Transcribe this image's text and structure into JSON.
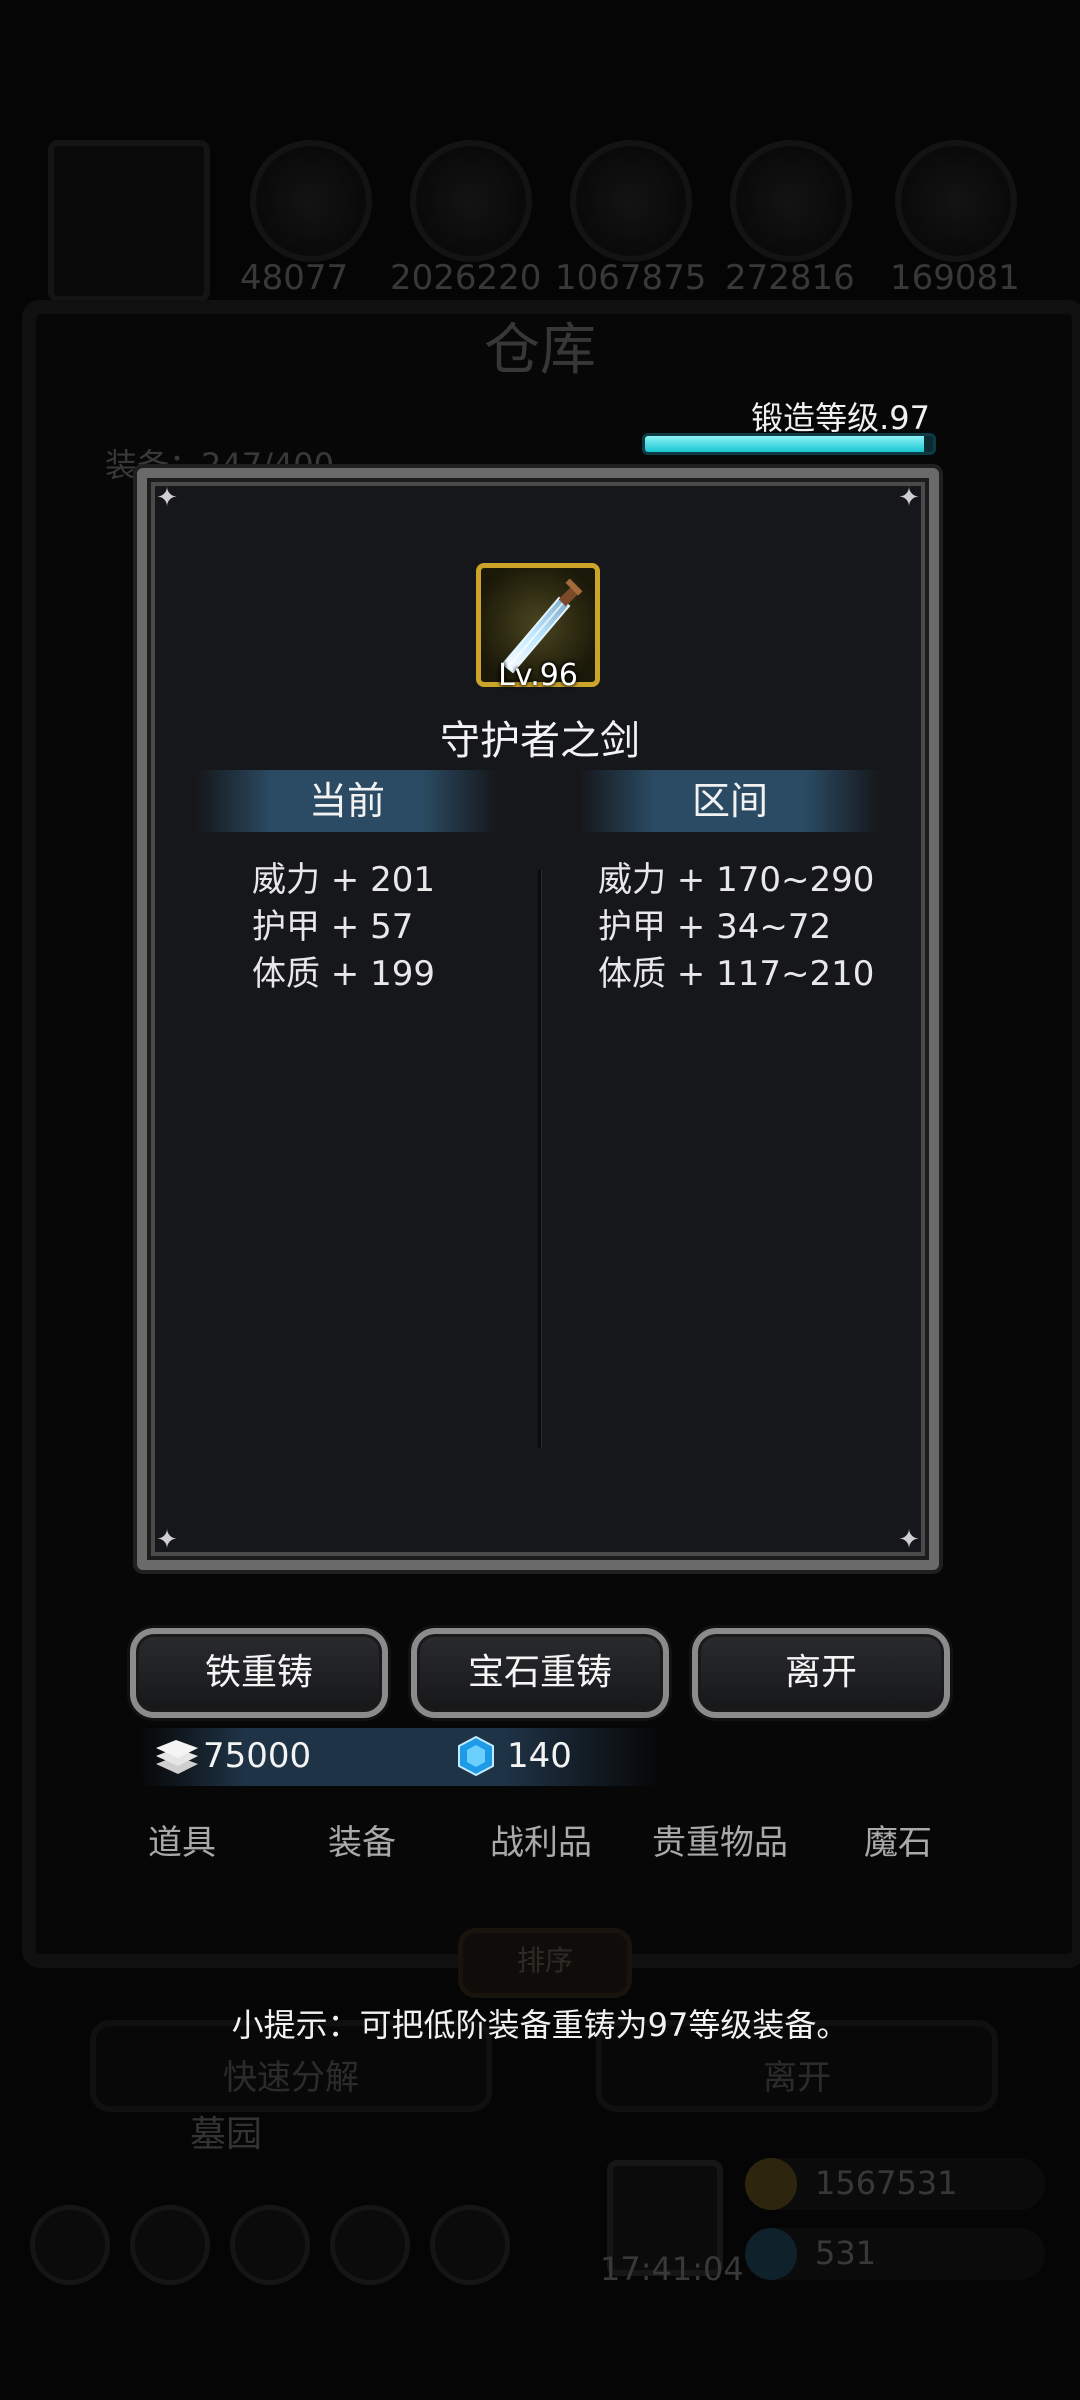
{
  "background": {
    "resource_values": [
      "48077",
      "2026220",
      "1067875",
      "272816",
      "169081"
    ],
    "title": "仓库",
    "equipment_count": "装备：247/400",
    "quick_decompose": "快速分解",
    "leave": "离开",
    "garden": "墓园",
    "gold": "1567531",
    "gems": "531",
    "timer": "17:41:04"
  },
  "forge": {
    "label": "锻造等级.97",
    "progress_fraction": 0.97
  },
  "item": {
    "level": "Lv.96",
    "name": "守护者之剑",
    "icon": "sword-icon",
    "frame_color": "#cca42a"
  },
  "columns": {
    "current": "当前",
    "range": "区间"
  },
  "current_stats": [
    "威力 + 201",
    "护甲 + 57",
    "体质 + 199"
  ],
  "range_stats": [
    "威力 + 170~290",
    "护甲 + 34~72",
    "体质 + 117~210"
  ],
  "actions": {
    "iron_reforge": "铁重铸",
    "gem_reforge": "宝石重铸",
    "leave": "离开"
  },
  "currency": {
    "iron": "75000",
    "gem": "140",
    "iron_icon": "iron-ingot-icon",
    "gem_icon": "blue-gem-icon"
  },
  "tabs": [
    "道具",
    "装备",
    "战利品",
    "贵重物品",
    "魔石"
  ],
  "sort_label": "排序",
  "tip": "小提示：可把低阶装备重铸为97等级装备。",
  "colors": {
    "accent_cyan": "#19c5d0",
    "gold_frame": "#cca42a",
    "dialog_bg": "#16171b"
  }
}
